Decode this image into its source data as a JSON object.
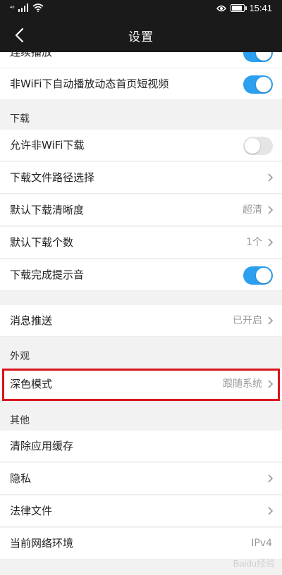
{
  "status_bar": {
    "network": "⁴⁶",
    "time": "15:41",
    "battery_level": 0.9
  },
  "header": {
    "title": "设置"
  },
  "rows": {
    "autoplay_partial": "连续播放",
    "nonwifi_autoplay": {
      "label": "非WiFi下自动播放动态首页短视频",
      "toggle": "on"
    },
    "allow_nonwifi_download": {
      "label": "允许非WiFi下载",
      "toggle": "off"
    },
    "download_path": {
      "label": "下载文件路径选择"
    },
    "default_quality": {
      "label": "默认下载清晰度",
      "value": "超清"
    },
    "default_count": {
      "label": "默认下载个数",
      "value": "1个"
    },
    "download_sound": {
      "label": "下载完成提示音",
      "toggle": "on"
    },
    "push": {
      "label": "消息推送",
      "value": "已开启"
    },
    "dark_mode": {
      "label": "深色模式",
      "value": "跟随系统"
    },
    "clear_cache": {
      "label": "清除应用缓存"
    },
    "privacy": {
      "label": "隐私"
    },
    "legal": {
      "label": "法律文件"
    },
    "network_env": {
      "label": "当前网络环境",
      "value": "IPv4"
    }
  },
  "sections": {
    "download": "下载",
    "appearance": "外观",
    "other": "其他"
  },
  "colors": {
    "accent": "#2d9ff0",
    "highlight": "#d9141b",
    "bar": "#1a1a1a"
  },
  "watermark": "Baidu经验"
}
